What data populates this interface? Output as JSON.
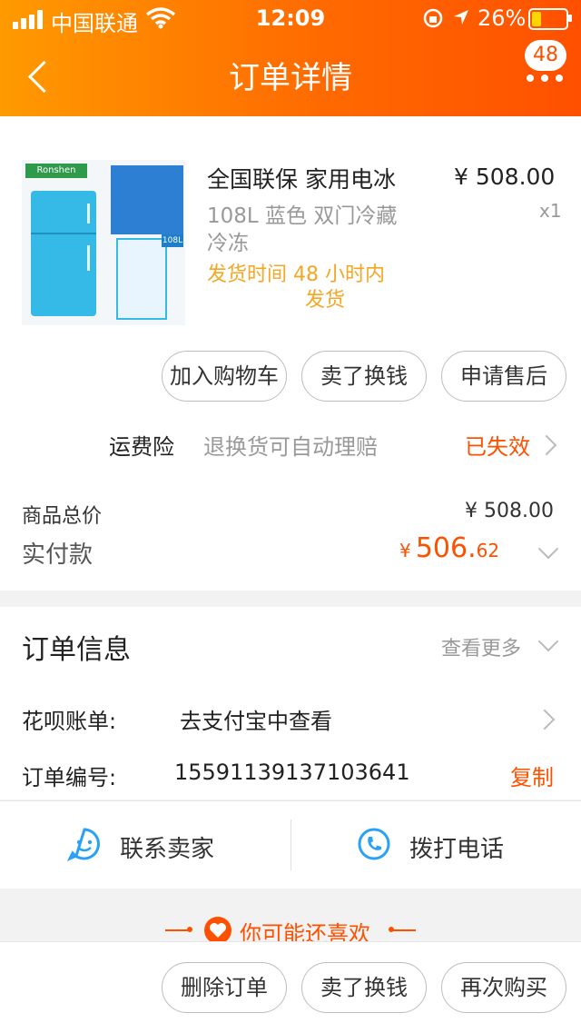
{
  "status_bar": {
    "carrier": "中国联通",
    "time": "12:09",
    "battery": "26%"
  },
  "header": {
    "title": "订单详情",
    "badge_count": "48"
  },
  "product": {
    "title_line": "全国联保 家用电冰",
    "spec_line1": "108L 蓝色 双门冷藏",
    "spec_line2": "冷冻",
    "ship_line1": "发货时间  48 小时内",
    "ship_line2": "发货",
    "price": "¥ 508.00",
    "qty": "x1",
    "image_brand": "Ronshen",
    "image_badge": "108L"
  },
  "actions": {
    "add_cart": "加入购物车",
    "sell": "卖了换钱",
    "after_sale": "申请售后"
  },
  "insurance": {
    "label": "运费险",
    "desc": "退换货可自动理赔",
    "status": "已失效"
  },
  "totals": {
    "goods_label": "商品总价",
    "goods_value": "¥ 508.00",
    "paid_label": "实付款",
    "paid_symbol": "¥",
    "paid_int": "506.",
    "paid_dec": "62"
  },
  "order_info": {
    "title": "订单信息",
    "more": "查看更多",
    "huabei_label": "花呗账单:",
    "huabei_value": "去支付宝中查看",
    "order_no_label": "订单编号:",
    "order_no": "1559113913710364​1",
    "copy": "复制"
  },
  "contact": {
    "seller": "联系卖家",
    "phone": "拨打电话"
  },
  "recommend": {
    "title": "你可能还喜欢"
  },
  "bottom": {
    "delete": "删除订单",
    "sell": "卖了换钱",
    "rebuy": "再次购买"
  },
  "colors": {
    "accent": "#ff5000",
    "header_start": "#ff9a00",
    "amber": "#f5a623",
    "icon_blue": "#29a1f7"
  }
}
